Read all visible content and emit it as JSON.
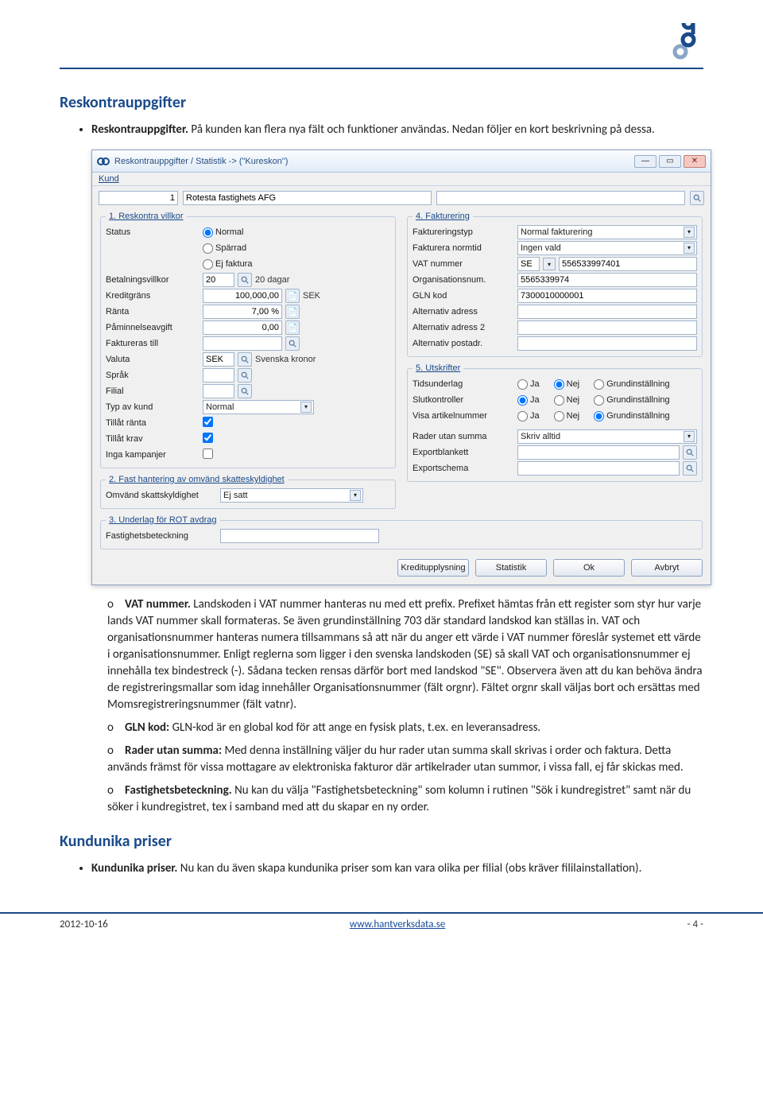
{
  "doc": {
    "heading1": "Reskontrauppgifter",
    "intro_bold": "Reskontrauppgifter.",
    "intro_rest": " På kunden kan flera nya fält och funktioner användas. Nedan följer en kort beskrivning på dessa.",
    "sublist": [
      {
        "marker": "o",
        "bold": "VAT nummer.",
        "text": " Landskoden i VAT nummer hanteras nu med ett prefix. Prefixet hämtas från ett register som styr hur varje lands VAT nummer skall formateras. Se även grundinställning 703 där standard landskod kan ställas in. VAT och organisationsnummer hanteras numera tillsammans så att när du anger ett värde i VAT nummer föreslår systemet ett värde i organisationsnummer. Enligt reglerna som ligger i den svenska landskoden (SE) så skall VAT och organisationsnummer ej innehålla tex bindestreck (-). Sådana tecken rensas därför bort med landskod \"SE\". Observera även att du kan behöva ändra de registreringsmallar som idag innehåller Organisationsnummer (fält orgnr). Fältet orgnr skall väljas bort och ersättas med Momsregistreringsnummer (fält vatnr)."
      },
      {
        "marker": "o",
        "bold": "GLN kod:",
        "text": " GLN-kod är en global kod för att ange en fysisk plats, t.ex. en leveransadress."
      },
      {
        "marker": "o",
        "bold": "Rader utan summa:",
        "text": " Med denna inställning väljer du hur rader utan summa skall skrivas i order och faktura. Detta används främst för vissa mottagare av elektroniska fakturor där artikelrader utan summor, i vissa fall, ej får skickas med."
      },
      {
        "marker": "o",
        "bold": "Fastighetsbeteckning.",
        "text": " Nu kan du välja \"Fastighetsbeteckning\" som kolumn i rutinen \"Sök i kundregistret\" samt när du söker i kundregistret, tex i samband med att du skapar en ny order."
      }
    ],
    "heading2": "Kundunika priser",
    "kp_bold": "Kundunika priser.",
    "kp_rest": " Nu kan du även skapa kundunika priser som kan vara olika per filial (obs kräver fililainstallation)."
  },
  "window": {
    "title": "Reskontrauppgifter / Statistik   ->   (\"Kureskon\")",
    "menu_kund": "Kund",
    "kund": {
      "id": "1",
      "name": "Rotesta fastighets AFG"
    },
    "group_reskontra": "1. Reskontra villkor",
    "labels": {
      "status": "Status",
      "status_normal": "Normal",
      "status_sparrad": "Spärrad",
      "status_ejfaktura": "Ej faktura",
      "betalningsvillkor": "Betalningsvillkor",
      "bet_value": "20",
      "bet_text": "20 dagar",
      "kreditgrans": "Kreditgräns",
      "kredit_value": "100,000,00",
      "kredit_cur": "SEK",
      "ranta": "Ränta",
      "ranta_value": "7,00 %",
      "paminnelseavgift": "Påminnelseavgift",
      "pam_value": "0,00",
      "faktureras_till": "Faktureras till",
      "valuta": "Valuta",
      "valuta_code": "SEK",
      "valuta_text": "Svenska kronor",
      "sprak": "Språk",
      "filial": "Filial",
      "typavkund": "Typ av kund",
      "typ_value": "Normal",
      "tillat_ranta": "Tillåt ränta",
      "tillat_krav": "Tillåt krav",
      "inga_kampanjer": "Inga kampanjer"
    },
    "group_fast": "2. Fast hantering av omvänd skatteskyldighet",
    "omvand_label": "Omvänd skattskyldighet",
    "omvand_value": "Ej satt",
    "group_rot": "3. Underlag för ROT avdrag",
    "fastbet_label": "Fastighetsbeteckning",
    "group_fakt": "4. Fakturering",
    "fakt": {
      "faktureringstyp": "Faktureringstyp",
      "faktureringstyp_value": "Normal fakturering",
      "fakturera_normtid": "Fakturera normtid",
      "fakturera_normtid_value": "Ingen vald",
      "vat_label": "VAT nummer",
      "vat_prefix": "SE",
      "vat_num": "556533997401",
      "orgnr_label": "Organisationsnum.",
      "orgnr_value": "5565339974",
      "gln_label": "GLN kod",
      "gln_value": "7300010000001",
      "alt_adress": "Alternativ adress",
      "alt_adress2": "Alternativ adress 2",
      "alt_postadr": "Alternativ postadr."
    },
    "group_utskr": "5. Utskrifter",
    "utskr": {
      "tidsunderlag": "Tidsunderlag",
      "slutkontroller": "Slutkontroller",
      "visa_artnr": "Visa artikelnummer",
      "ja": "Ja",
      "nej": "Nej",
      "grund": "Grundinställning",
      "rader_label": "Rader utan summa",
      "rader_value": "Skriv alltid",
      "exportblankett": "Exportblankett",
      "exportschema": "Exportschema"
    },
    "actions": {
      "kreditupplysning": "Kreditupplysning",
      "statistik": "Statistik",
      "ok": "Ok",
      "avbryt": "Avbryt"
    }
  },
  "footer": {
    "date": "2012-10-16",
    "site": "www.hantverksdata.se",
    "page": "- 4 -"
  }
}
